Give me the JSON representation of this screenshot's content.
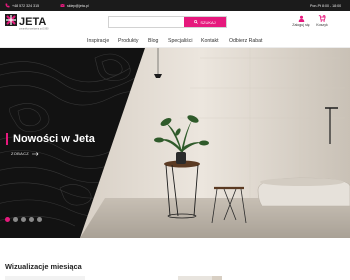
{
  "topbar": {
    "phone": "+48 572 324 315",
    "email": "sklep@jeta.pl",
    "hours": "Pon-Pt 8:00 - 18:00"
  },
  "header": {
    "logo_text": "JETA",
    "logo_tagline": "ceramika sanitarna od 1990",
    "search_placeholder": "",
    "search_button": "SZUKAJ",
    "account_label": "Zaloguj się",
    "cart_label": "Koszyk",
    "cart_count": "0"
  },
  "nav": {
    "items": [
      "Inspiracje",
      "Produkty",
      "Blog",
      "Specjaliści",
      "Kontakt",
      "Odbierz Rabat"
    ]
  },
  "hero": {
    "title": "Nowości w Jeta",
    "link_label": "ZOBACZ",
    "slides_count": 5,
    "active_slide": 1
  },
  "section": {
    "title": "Wizualizacje miesiąca"
  },
  "colors": {
    "accent": "#e6197d",
    "topbar": "#1b1b1b",
    "hero_dark": "#121212"
  }
}
